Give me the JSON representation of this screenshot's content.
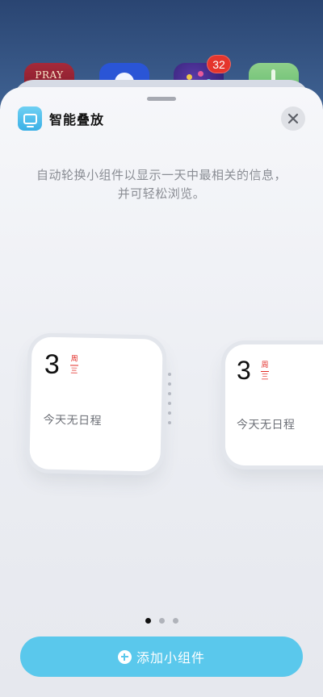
{
  "background": {
    "apps": [
      {
        "name": "pray-app",
        "label": "PRAY"
      },
      {
        "name": "blue-app"
      },
      {
        "name": "purple-app",
        "badge": "32"
      },
      {
        "name": "green-app"
      }
    ]
  },
  "sheet": {
    "title": "智能叠放",
    "description_line1": "自动轮换小组件以显示一天中最相关的信息，",
    "description_line2": "并可轻松浏览。",
    "close_icon": "close-icon"
  },
  "widgets": [
    {
      "day": "3",
      "weekday_top": "周",
      "weekday_bottom": "三",
      "text": "今天无日程"
    },
    {
      "day": "3",
      "weekday_top": "周",
      "weekday_bottom": "三",
      "text": "今天无日程"
    }
  ],
  "pagination": {
    "total": 3,
    "active": 0
  },
  "add_button": {
    "label": "添加小组件",
    "icon": "plus-circle-icon"
  },
  "colors": {
    "accent": "#5ac8ec",
    "calendar_red": "#e22a24",
    "badge_red": "#e5352c"
  }
}
